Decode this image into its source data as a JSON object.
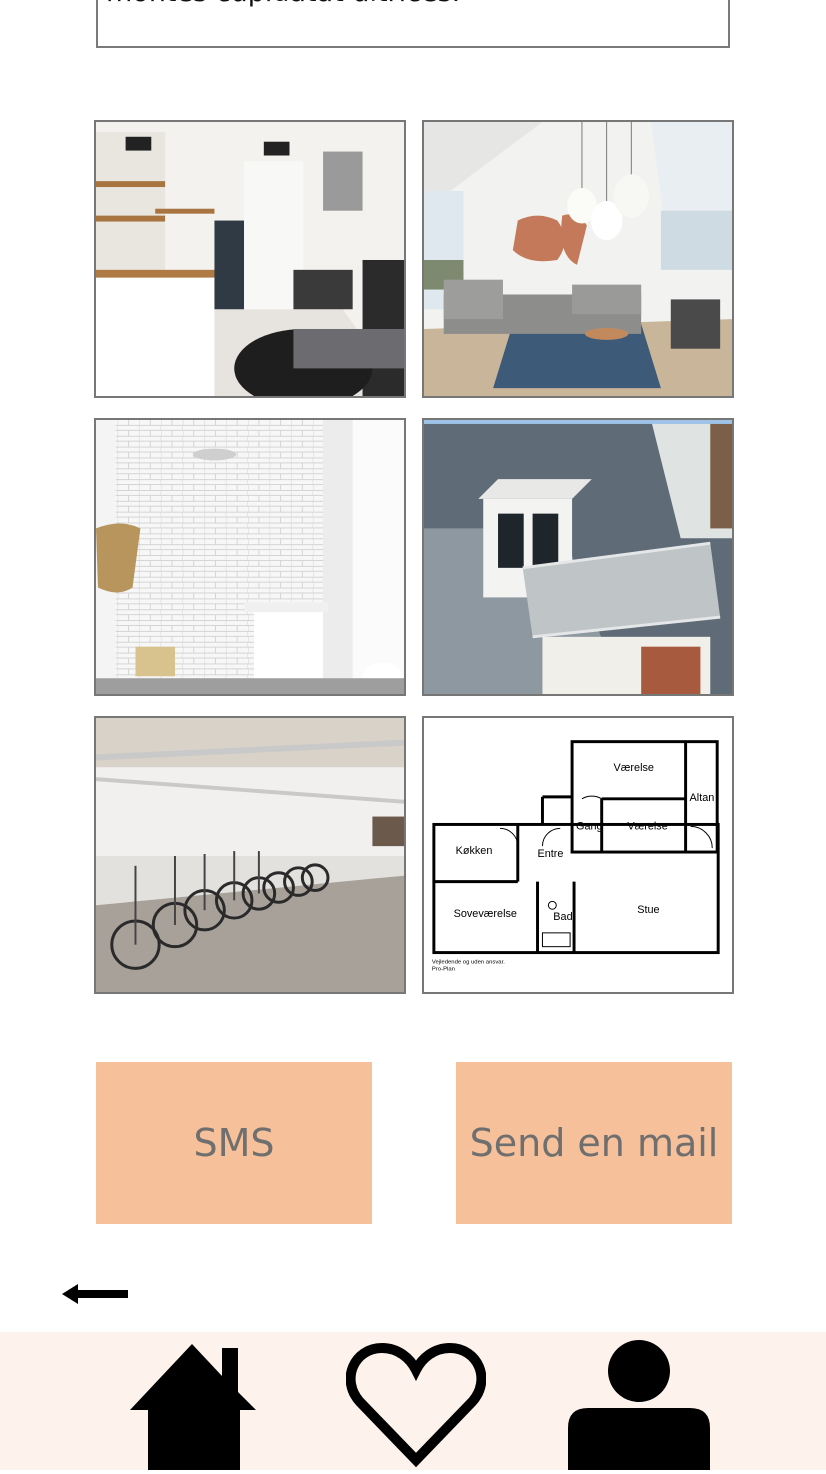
{
  "listing": {
    "description_tail": "montes cupidatat ultrices."
  },
  "gallery": {
    "photos": [
      {
        "subject": "kitchen"
      },
      {
        "subject": "living-room"
      },
      {
        "subject": "bathroom"
      },
      {
        "subject": "roof-terrace"
      },
      {
        "subject": "bike-storage"
      },
      {
        "subject": "floor-plan"
      }
    ],
    "floor_plan": {
      "rooms": [
        "Værelse",
        "Altan",
        "Gang",
        "Værelse",
        "Køkken",
        "Entre",
        "Soveværelse",
        "Bad",
        "Stue"
      ],
      "note_line1": "Vejledende og uden ansvar.",
      "note_line2": "Pro-Plan"
    }
  },
  "actions": {
    "sms_label": "SMS",
    "mail_label": "Send en mail"
  },
  "navigation": {
    "back_icon": "arrow-left-icon",
    "items": [
      {
        "icon": "home-icon"
      },
      {
        "icon": "heart-icon"
      },
      {
        "icon": "user-icon"
      }
    ]
  },
  "colors": {
    "button_bg": "#f5c09a",
    "button_text": "#6f6f6f",
    "nav_bg": "#fdf3ec"
  }
}
